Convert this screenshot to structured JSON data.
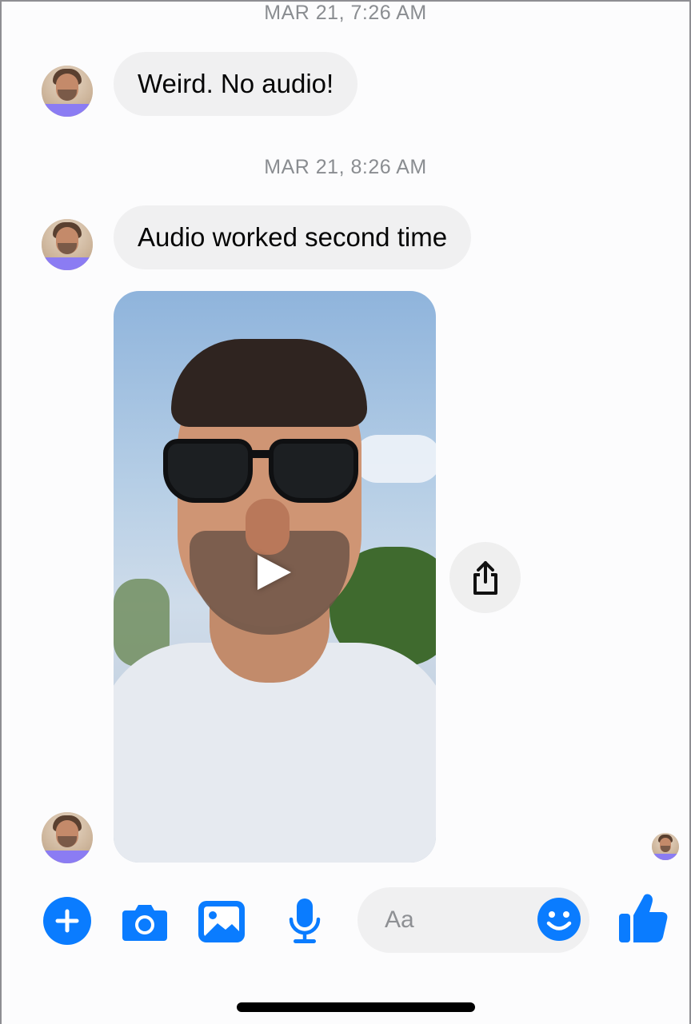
{
  "conversation": {
    "timestamp_1": "MAR 21, 7:26 AM",
    "message_1": "Weird. No audio!",
    "timestamp_2": "MAR 21, 8:26 AM",
    "message_2": "Audio worked second time"
  },
  "video_message": {
    "play_icon": "play-icon",
    "share_icon": "share-icon"
  },
  "composer": {
    "placeholder": "Aa",
    "icons": [
      "plus-icon",
      "camera-icon",
      "image-icon",
      "microphone-icon",
      "emoji-icon",
      "thumbs-up-icon"
    ]
  },
  "colors": {
    "accent": "#0a7cff",
    "bubble_background": "#f0f0f1",
    "timestamp_text": "#8a8d91",
    "avatar_band": "#8b7cf3"
  }
}
